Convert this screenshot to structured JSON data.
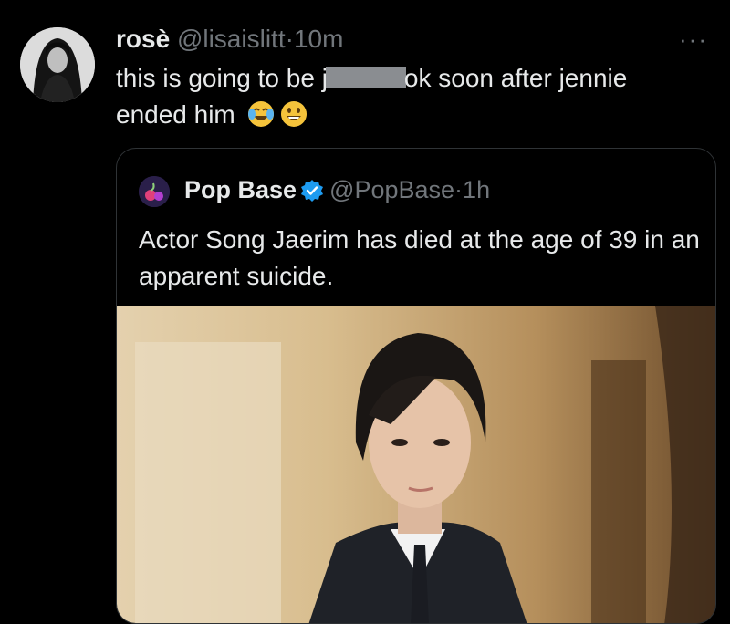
{
  "tweet": {
    "display_name": "rosè",
    "handle": "@lisaislitt",
    "separator": "·",
    "time": "10m",
    "more_label": "···",
    "text_part1": "this is going to be j",
    "text_part2": "ok soon after jennie",
    "text_part3": "ended him",
    "emojis": [
      "face-with-tears-of-joy-icon",
      "grinning-face-icon"
    ]
  },
  "quote": {
    "display_name": "Pop Base",
    "handle": "@PopBase",
    "separator": "·",
    "time": "1h",
    "text": "Actor Song Jaerim has died at the age of 39 in an apparent suicide.",
    "verified_color": "#1d9bf0"
  },
  "colors": {
    "background": "#000000",
    "text": "#e7e9ea",
    "muted": "#71767b",
    "border": "#2f3336"
  }
}
